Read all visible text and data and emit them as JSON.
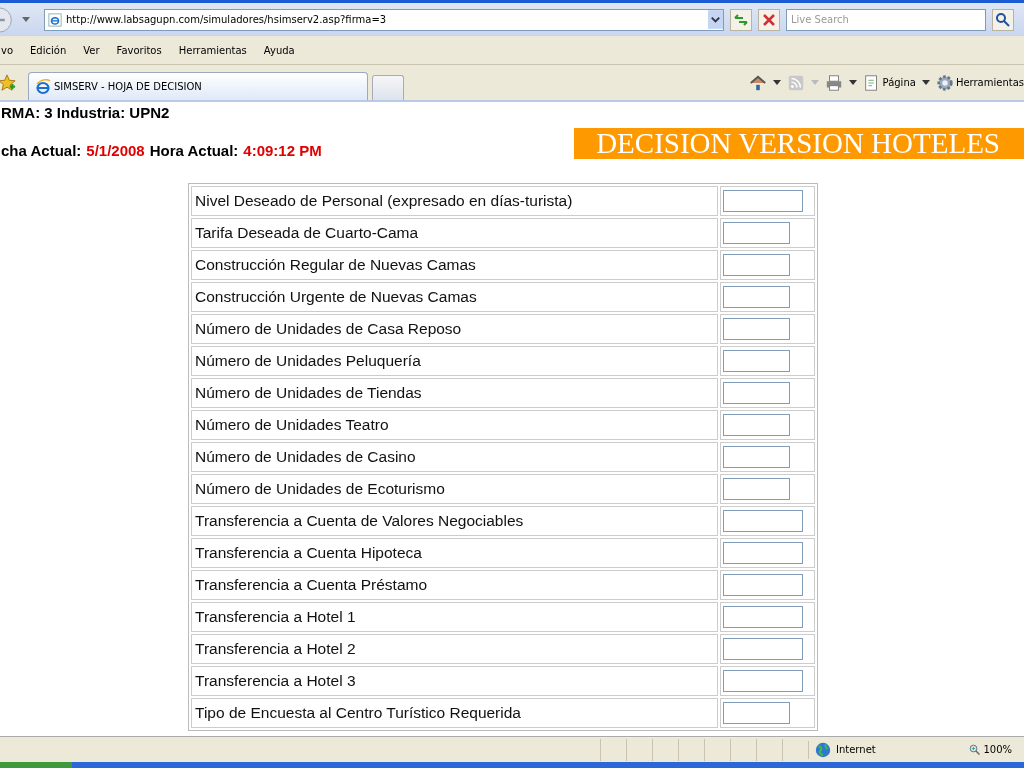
{
  "browser": {
    "address": "http://www.labsagupn.com/simuladores/hsimserv2.asp?firma=3",
    "search": {
      "placeholder": "Live Search"
    },
    "menu": [
      "vo",
      "Edición",
      "Ver",
      "Favoritos",
      "Herramientas",
      "Ayuda"
    ],
    "tab": {
      "title": "SIMSERV - HOJA DE DECISION"
    },
    "tools": [
      "Página",
      "Herramientas"
    ]
  },
  "page": {
    "firm_line": "RMA: 3 Industria: UPN2",
    "date_label": "cha Actual:",
    "date": "5/1/2008",
    "time_label": "Hora Actual:",
    "time": "4:09:12 PM",
    "banner": "DECISION VERSION HOTELES",
    "rows": [
      {
        "label": "Nivel Deseado de Personal (expresado en días-turista)",
        "kind": "wide"
      },
      {
        "label": "Tarifa Deseada de Cuarto-Cama",
        "kind": "narrow"
      },
      {
        "label": "Construcción Regular de Nuevas Camas",
        "kind": "narrow"
      },
      {
        "label": "Construcción Urgente de Nuevas Camas",
        "kind": "narrow"
      },
      {
        "label": "Número de Unidades de Casa Reposo",
        "kind": "narrow"
      },
      {
        "label": "Número de Unidades Peluquería",
        "kind": "narrow"
      },
      {
        "label": "Número de Unidades de Tiendas",
        "kind": "narrow"
      },
      {
        "label": "Número de Unidades Teatro",
        "kind": "narrow"
      },
      {
        "label": "Número de Unidades de Casino",
        "kind": "narrow"
      },
      {
        "label": "Número de Unidades de Ecoturismo",
        "kind": "narrow"
      },
      {
        "label": "Transferencia a Cuenta de Valores Negociables",
        "kind": "wide"
      },
      {
        "label": "Transferencia a Cuenta Hipoteca",
        "kind": "wide"
      },
      {
        "label": "Transferencia a Cuenta Préstamo",
        "kind": "wide"
      },
      {
        "label": "Transferencia a Hotel 1",
        "kind": "wide"
      },
      {
        "label": "Transferencia a Hotel 2",
        "kind": "wide"
      },
      {
        "label": "Transferencia a Hotel 3",
        "kind": "wide"
      },
      {
        "label": "Tipo de Encuesta al Centro Turístico Requerida",
        "kind": "narrow"
      }
    ]
  },
  "status_bar": {
    "zone": "Internet",
    "zoom": "100%"
  }
}
